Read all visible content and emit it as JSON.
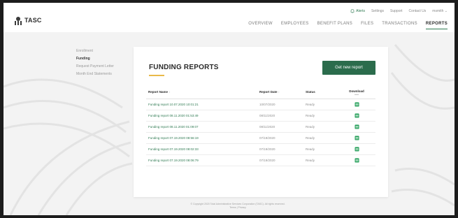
{
  "app": {
    "logo_text": "TASC"
  },
  "utility_links": {
    "alerts": "Alerts",
    "settings": "Settings",
    "support": "Support",
    "contact_us": "Contact Us",
    "user": "msmith"
  },
  "nav": {
    "items": [
      "OVERVIEW",
      "EMPLOYEES",
      "BENEFIT PLANS",
      "FILES",
      "TRANSACTIONS",
      "REPORTS"
    ],
    "active": "REPORTS"
  },
  "sidebar": {
    "items": [
      "Enrollment",
      "Funding",
      "Request Payment Letter",
      "Month End Statements"
    ],
    "active": "Funding"
  },
  "main": {
    "title": "FUNDING REPORTS",
    "new_report_button": "Get new report",
    "table": {
      "columns": [
        "Report Name",
        "Report Date",
        "Status",
        "Download"
      ],
      "rows": [
        {
          "name": "Funding report 10.07.2020 10:01:21",
          "date": "10/07/2020",
          "status": "Ready"
        },
        {
          "name": "Funding report 08.11.2020 01:53:49",
          "date": "08/11/2020",
          "status": "Ready"
        },
        {
          "name": "Funding report 08.11.2020 01:09:07",
          "date": "08/11/2020",
          "status": "Ready"
        },
        {
          "name": "Funding report 07.19.2020 08:56:19",
          "date": "07/19/2020",
          "status": "Ready"
        },
        {
          "name": "Funding report 07.19.2020 08:02:33",
          "date": "07/19/2020",
          "status": "Ready"
        },
        {
          "name": "Funding report 07.19.2020 08:06:79",
          "date": "07/19/2020",
          "status": "Ready"
        }
      ]
    }
  },
  "footer": {
    "line1": "© Copyright 2020 Total Administrative Services Corporation (TASC). All rights reserved.",
    "line2": "Terms | Privacy"
  },
  "colors": {
    "accent_green": "#2b6c4c",
    "link_green": "#2f7a52",
    "underline_gold": "#e9b949"
  },
  "icons": {
    "logo": "tasc-logo-icon",
    "alerts": "bell-icon",
    "download": "excel-file-icon"
  }
}
